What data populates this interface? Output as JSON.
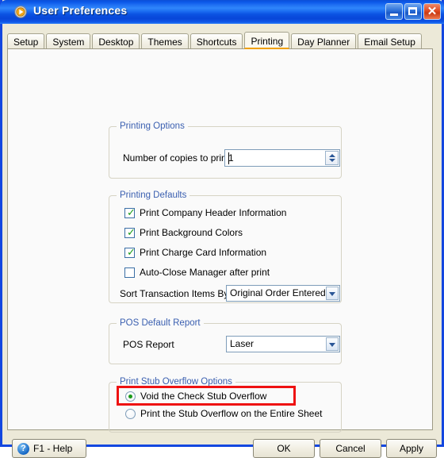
{
  "window": {
    "title": "User Preferences",
    "app_icon": "play-circle-icon",
    "controls": {
      "minimize": "minimize-icon",
      "maximize": "maximize-icon",
      "close": "close-icon"
    }
  },
  "tabs": [
    {
      "label": "Setup",
      "active": false
    },
    {
      "label": "System",
      "active": false
    },
    {
      "label": "Desktop",
      "active": false
    },
    {
      "label": "Themes",
      "active": false
    },
    {
      "label": "Shortcuts",
      "active": false
    },
    {
      "label": "Printing",
      "active": true
    },
    {
      "label": "Day Planner",
      "active": false
    },
    {
      "label": "Email Setup",
      "active": false
    }
  ],
  "groups": {
    "printing_options": {
      "title": "Printing Options",
      "copies_label": "Number of copies to print",
      "copies_value": "1"
    },
    "printing_defaults": {
      "title": "Printing Defaults",
      "checkboxes": [
        {
          "label": "Print Company Header Information",
          "checked": true
        },
        {
          "label": "Print Background Colors",
          "checked": true
        },
        {
          "label": "Print Charge Card Information",
          "checked": true
        },
        {
          "label": "Auto-Close Manager after print",
          "checked": false
        }
      ],
      "sort_label": "Sort Transaction Items By",
      "sort_value": "Original Order Entered"
    },
    "pos_default_report": {
      "title": "POS Default Report",
      "report_label": "POS Report",
      "report_value": "Laser"
    },
    "stub_overflow": {
      "title": "Print Stub Overflow Options",
      "radios": [
        {
          "label": "Void the Check Stub Overflow",
          "selected": true
        },
        {
          "label": "Print the Stub Overflow on the Entire Sheet",
          "selected": false
        }
      ]
    }
  },
  "footer": {
    "help_label": "F1 - Help",
    "help_icon": "question-mark-icon",
    "ok_label": "OK",
    "cancel_label": "Cancel",
    "apply_label": "Apply"
  },
  "annotations": {
    "tab_highlight_color": "#ffef5a",
    "callout_box_color": "#ee1111"
  },
  "colors": {
    "titlebar_blue": "#0a57e8",
    "window_border": "#1347e0",
    "group_title": "#3a5fb0",
    "check_green": "#1a9a1a",
    "dialog_face": "#ece9d8",
    "panel_face": "#fafafa"
  }
}
